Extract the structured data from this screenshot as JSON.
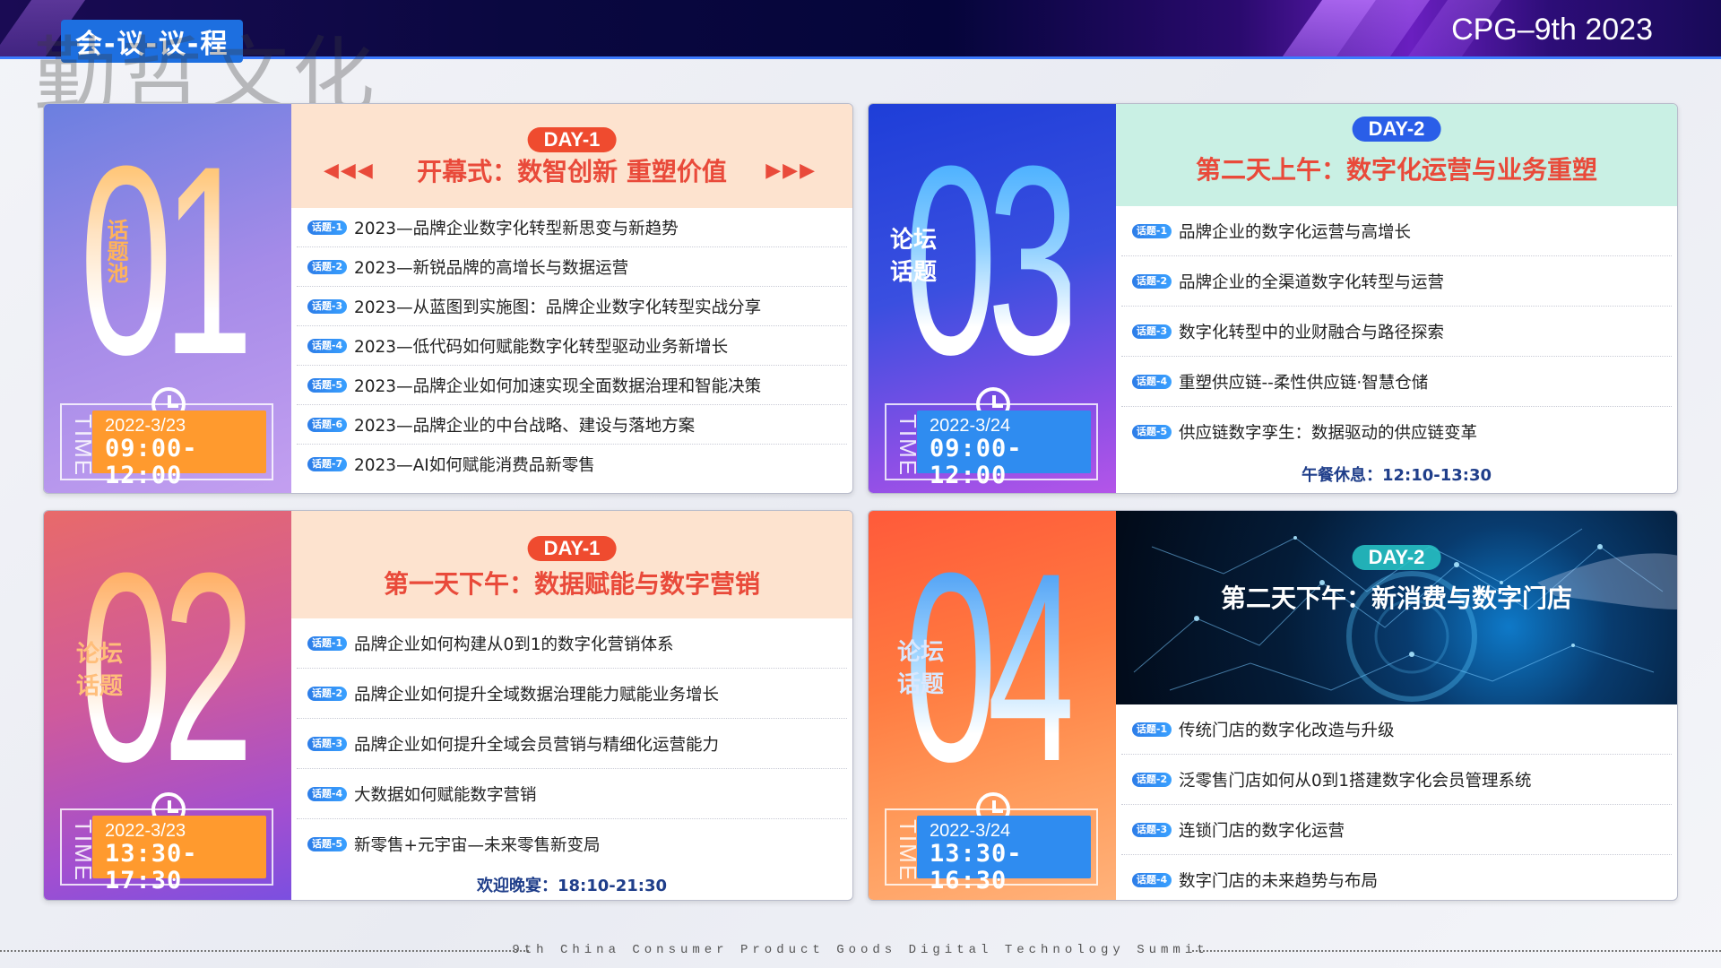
{
  "header": {
    "agenda_badge": "会-议-议-程",
    "watermark": "勤哲文化",
    "title": "CPG–9th 2023"
  },
  "footer": {
    "tagline": "9th China Consumer Product Goods Digital Technology Summit"
  },
  "common": {
    "time_label": "TIME",
    "topic_tag": "话题池",
    "forum_tag_line1": "论坛",
    "forum_tag_line2": "话题"
  },
  "cards": [
    {
      "number": "01",
      "day": "DAY-1",
      "title": "开幕式：数智创新 重塑价值",
      "date": "2022-3/23",
      "time": "09:00-12:00",
      "topics": [
        {
          "badge": "话题-1",
          "text": "2023—品牌企业数字化转型新思变与新趋势"
        },
        {
          "badge": "话题-2",
          "text": "2023—新锐品牌的高增长与数据运营"
        },
        {
          "badge": "话题-3",
          "text": "2023—从蓝图到实施图：品牌企业数字化转型实战分享"
        },
        {
          "badge": "话题-4",
          "text": "2023—低代码如何赋能数字化转型驱动业务新增长"
        },
        {
          "badge": "话题-5",
          "text": "2023—品牌企业如何加速实现全面数据治理和智能决策"
        },
        {
          "badge": "话题-6",
          "text": "2023—品牌企业的中台战略、建设与落地方案"
        },
        {
          "badge": "话题-7",
          "text": "2023—AI如何赋能消费品新零售"
        }
      ]
    },
    {
      "number": "03",
      "day": "DAY-2",
      "title": "第二天上午：数字化运营与业务重塑",
      "date": "2022-3/24",
      "time": "09:00-12:00",
      "note": "午餐休息：12:10-13:30",
      "topics": [
        {
          "badge": "话题-1",
          "text": "品牌企业的数字化运营与高增长"
        },
        {
          "badge": "话题-2",
          "text": "品牌企业的全渠道数字化转型与运营"
        },
        {
          "badge": "话题-3",
          "text": "数字化转型中的业财融合与路径探索"
        },
        {
          "badge": "话题-4",
          "text": "重塑供应链--柔性供应链·智慧仓储"
        },
        {
          "badge": "话题-5",
          "text": "供应链数字孪生：数据驱动的供应链变革"
        }
      ]
    },
    {
      "number": "02",
      "day": "DAY-1",
      "title": "第一天下午：数据赋能与数字营销",
      "date": "2022-3/23",
      "time": "13:30-17:30",
      "note": "欢迎晚宴：18:10-21:30",
      "topics": [
        {
          "badge": "话题-1",
          "text": "品牌企业如何构建从0到1的数字化营销体系"
        },
        {
          "badge": "话题-2",
          "text": "品牌企业如何提升全域数据治理能力赋能业务增长"
        },
        {
          "badge": "话题-3",
          "text": "品牌企业如何提升全域会员营销与精细化运营能力"
        },
        {
          "badge": "话题-4",
          "text": "大数据如何赋能数字营销"
        },
        {
          "badge": "话题-5",
          "text": "新零售+元宇宙—未来零售新变局"
        }
      ]
    },
    {
      "number": "04",
      "day": "DAY-2",
      "title": "第二天下午：新消费与数字门店",
      "date": "2022-3/24",
      "time": "13:30-16:30",
      "topics": [
        {
          "badge": "话题-1",
          "text": "传统门店的数字化改造与升级"
        },
        {
          "badge": "话题-2",
          "text": "泛零售门店如何从0到1搭建数字化会员管理系统"
        },
        {
          "badge": "话题-3",
          "text": "连锁门店的数字化运营"
        },
        {
          "badge": "话题-4",
          "text": "数字门店的未来趋势与布局"
        }
      ]
    }
  ],
  "colors": {
    "orange": "#ff9a2e",
    "blue": "#2f8cf0",
    "red_title": "#e94a3a",
    "dark_blue_note": "#1f3e8a"
  }
}
